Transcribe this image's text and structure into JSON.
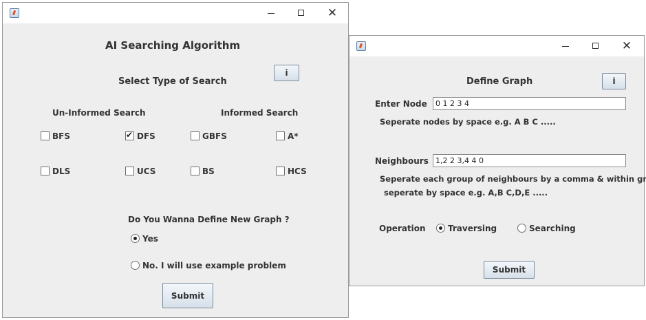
{
  "search_window": {
    "title": "AI Searching Algorithm",
    "info_button": "i",
    "select_heading": "Select Type of Search",
    "uninformed_heading": "Un-Informed Search",
    "informed_heading": "Informed Search",
    "options": {
      "bfs": {
        "label": "BFS",
        "checked": false
      },
      "dfs": {
        "label": "DFS",
        "checked": true
      },
      "gbfs": {
        "label": "GBFS",
        "checked": false
      },
      "astar": {
        "label": "A*",
        "checked": false
      },
      "dls": {
        "label": "DLS",
        "checked": false
      },
      "ucs": {
        "label": "UCS",
        "checked": false
      },
      "bs": {
        "label": "BS",
        "checked": false
      },
      "hcs": {
        "label": "HCS",
        "checked": false
      }
    },
    "question": "Do You Wanna Define New Graph ?",
    "yes_label": "Yes",
    "no_label": "No. I will use example problem",
    "selected": "Yes",
    "submit_label": "Submit"
  },
  "graph_window": {
    "title": "Define Graph",
    "info_button": "i",
    "node_label": "Enter Node",
    "node_value": "0 1 2 3 4",
    "node_hint": "Seperate nodes by space e.g. A B C .....",
    "neighbours_label": "Neighbours",
    "neighbours_value": "1,2 2 3,4 4 0",
    "neighbours_hint_1": "Seperate each group of neighbours by a comma & within group",
    "neighbours_hint_2": "seperate by space e.g. A,B C,D,E .....",
    "operation_label": "Operation",
    "traversing_label": "Traversing",
    "searching_label": "Searching",
    "selected_operation": "Traversing",
    "submit_label": "Submit"
  }
}
